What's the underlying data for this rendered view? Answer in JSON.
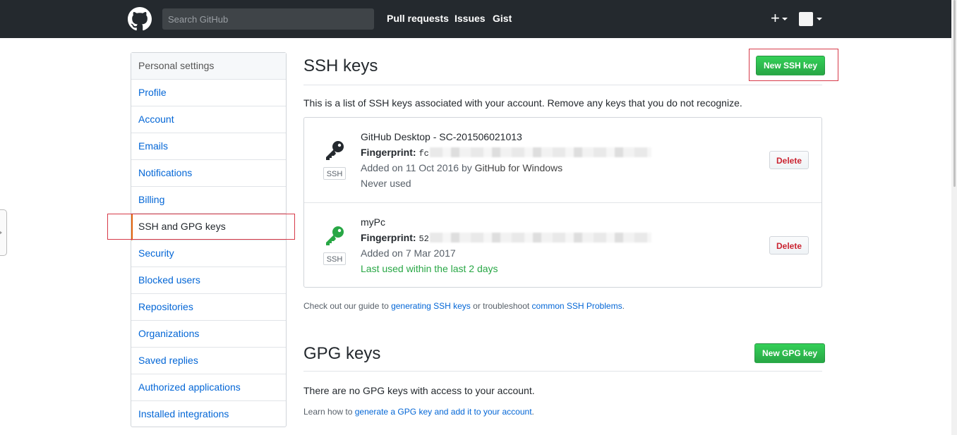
{
  "header": {
    "search_placeholder": "Search GitHub",
    "nav": [
      "Pull requests",
      "Issues",
      "Gist"
    ],
    "new_menu_label": "+"
  },
  "sidebar": {
    "heading": "Personal settings",
    "items": [
      {
        "label": "Profile"
      },
      {
        "label": "Account"
      },
      {
        "label": "Emails"
      },
      {
        "label": "Notifications"
      },
      {
        "label": "Billing"
      },
      {
        "label": "SSH and GPG keys",
        "selected": true
      },
      {
        "label": "Security"
      },
      {
        "label": "Blocked users"
      },
      {
        "label": "Repositories"
      },
      {
        "label": "Organizations"
      },
      {
        "label": "Saved replies"
      },
      {
        "label": "Authorized applications"
      },
      {
        "label": "Installed integrations"
      }
    ]
  },
  "ssh": {
    "title": "SSH keys",
    "new_button": "New SSH key",
    "intro": "This is a list of SSH keys associated with your account. Remove any keys that you do not recognize.",
    "keys": [
      {
        "name": "GitHub Desktop - SC-201506021013",
        "fingerprint_label": "Fingerprint:",
        "fingerprint_visible": "fc",
        "added_prefix": "Added on 11 Oct 2016 by ",
        "added_by": "GitHub for Windows",
        "usage": "Never used",
        "badge": "SSH",
        "delete_label": "Delete",
        "icon": "key-icon",
        "icon_color": "#24292e"
      },
      {
        "name": "myPc",
        "fingerprint_label": "Fingerprint:",
        "fingerprint_visible": "52:",
        "added_prefix": "Added on 7 Mar 2017",
        "added_by": "",
        "usage": "Last used within the last 2 days",
        "badge": "SSH",
        "delete_label": "Delete",
        "icon": "key-icon",
        "icon_color": "#28a745"
      }
    ],
    "guide_prefix": "Check out our guide to ",
    "guide_link1": "generating SSH keys",
    "guide_middle": " or troubleshoot ",
    "guide_link2": "common SSH Problems",
    "guide_suffix": "."
  },
  "gpg": {
    "title": "GPG keys",
    "new_button": "New GPG key",
    "empty": "There are no GPG keys with access to your account.",
    "learn_prefix": "Learn how to ",
    "learn_link": "generate a GPG key and add it to your account",
    "learn_suffix": "."
  },
  "colors": {
    "header_bg": "#24292e",
    "link": "#0366d6",
    "green": "#28a745",
    "danger": "#cb2431",
    "highlight_border": "#d73a49"
  }
}
